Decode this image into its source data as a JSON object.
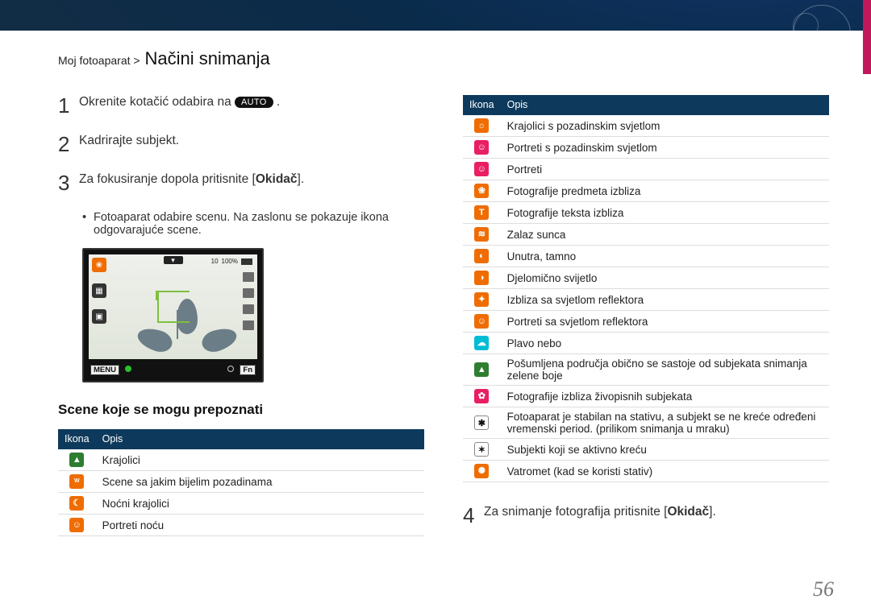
{
  "breadcrumb": {
    "path": "Moj fotoaparat >",
    "title": "Načini snimanja"
  },
  "steps": {
    "s1_num": "1",
    "s1_pre": "Okrenite kotačić odabira na ",
    "s1_badge": "AUTO",
    "s1_post": " .",
    "s2_num": "2",
    "s2": "Kadrirajte subjekt.",
    "s3_num": "3",
    "s3_pre": "Za fokusiranje dopola pritisnite [",
    "s3_em": "Okidač",
    "s3_post": "].",
    "bullet": "Fotoaparat odabire scenu. Na zaslonu se pokazuje ikona odgovarajuće scene.",
    "s4_num": "4",
    "s4_pre": "Za snimanje fotografija pritisnite [",
    "s4_em": "Okidač",
    "s4_post": "]."
  },
  "preview": {
    "top_count": "10",
    "top_percent": "100%",
    "menu": "MENU",
    "fn": "Fn"
  },
  "subhead": "Scene koje se mogu prepoznati",
  "thead": {
    "ikona": "Ikona",
    "opis": "Opis"
  },
  "left_rows": [
    {
      "iconName": "landscape-icon",
      "bg": "#2e7d32",
      "glyph": "▲",
      "desc": "Krajolici"
    },
    {
      "iconName": "white-bg-icon",
      "bg": "#ef6c00",
      "glyph": "W",
      "fs": "7px",
      "desc": "Scene sa jakim bijelim pozadinama"
    },
    {
      "iconName": "night-landscape-icon",
      "bg": "#ef6c00",
      "glyph": "☾",
      "desc": "Noćni krajolici"
    },
    {
      "iconName": "night-portrait-icon",
      "bg": "#ef6c00",
      "glyph": "☺",
      "desc": "Portreti noću"
    }
  ],
  "right_rows": [
    {
      "iconName": "backlit-landscape-icon",
      "bg": "#ef6c00",
      "glyph": "☼",
      "desc": "Krajolici s pozadinskim svjetlom"
    },
    {
      "iconName": "backlit-portrait-icon",
      "bg": "#e91e63",
      "glyph": "☺",
      "desc": "Portreti s pozadinskim svjetlom"
    },
    {
      "iconName": "portrait-icon",
      "bg": "#e91e63",
      "glyph": "☺",
      "desc": "Portreti"
    },
    {
      "iconName": "macro-object-icon",
      "bg": "#ef6c00",
      "glyph": "❀",
      "desc": "Fotografije predmeta izbliza"
    },
    {
      "iconName": "macro-text-icon",
      "bg": "#ef6c00",
      "glyph": "T",
      "desc": "Fotografije teksta izbliza"
    },
    {
      "iconName": "sunset-icon",
      "bg": "#ef6c00",
      "glyph": "≋",
      "desc": "Zalaz sunca"
    },
    {
      "iconName": "indoor-dark-icon",
      "bg": "#ef6c00",
      "glyph": "◐",
      "desc": "Unutra, tamno"
    },
    {
      "iconName": "partial-light-icon",
      "bg": "#ef6c00",
      "glyph": "◑",
      "desc": "Djelomično svijetlo"
    },
    {
      "iconName": "spotlight-macro-icon",
      "bg": "#ef6c00",
      "glyph": "✦",
      "desc": "Izbliza sa svjetlom reflektora"
    },
    {
      "iconName": "spotlight-portrait-icon",
      "bg": "#ef6c00",
      "glyph": "☺",
      "desc": "Portreti sa svjetlom reflektora"
    },
    {
      "iconName": "blue-sky-icon",
      "bg": "#00bcd4",
      "glyph": "☁",
      "desc": "Plavo nebo"
    },
    {
      "iconName": "greenery-icon",
      "bg": "#2e7d32",
      "glyph": "▲",
      "desc": "Pošumljena područja obično se sastoje od subjekata snimanja zelene boje"
    },
    {
      "iconName": "colorful-macro-icon",
      "bg": "#e91e63",
      "glyph": "✿",
      "desc": "Fotografije izbliza živopisnih subjekata"
    },
    {
      "iconName": "tripod-still-icon",
      "bg": "#ffffff",
      "glyph": "✱",
      "fg": "#111",
      "desc": "Fotoaparat je stabilan na stativu, a subjekt se ne kreće određeni vremenski period. (prilikom snimanja u mraku)"
    },
    {
      "iconName": "moving-subject-icon",
      "bg": "#ffffff",
      "glyph": "✶",
      "fg": "#111",
      "desc": "Subjekti koji se aktivno kreću"
    },
    {
      "iconName": "fireworks-tripod-icon",
      "bg": "#ef6c00",
      "glyph": "✺",
      "desc": "Vatromet (kad se koristi stativ)"
    }
  ],
  "page": "56"
}
